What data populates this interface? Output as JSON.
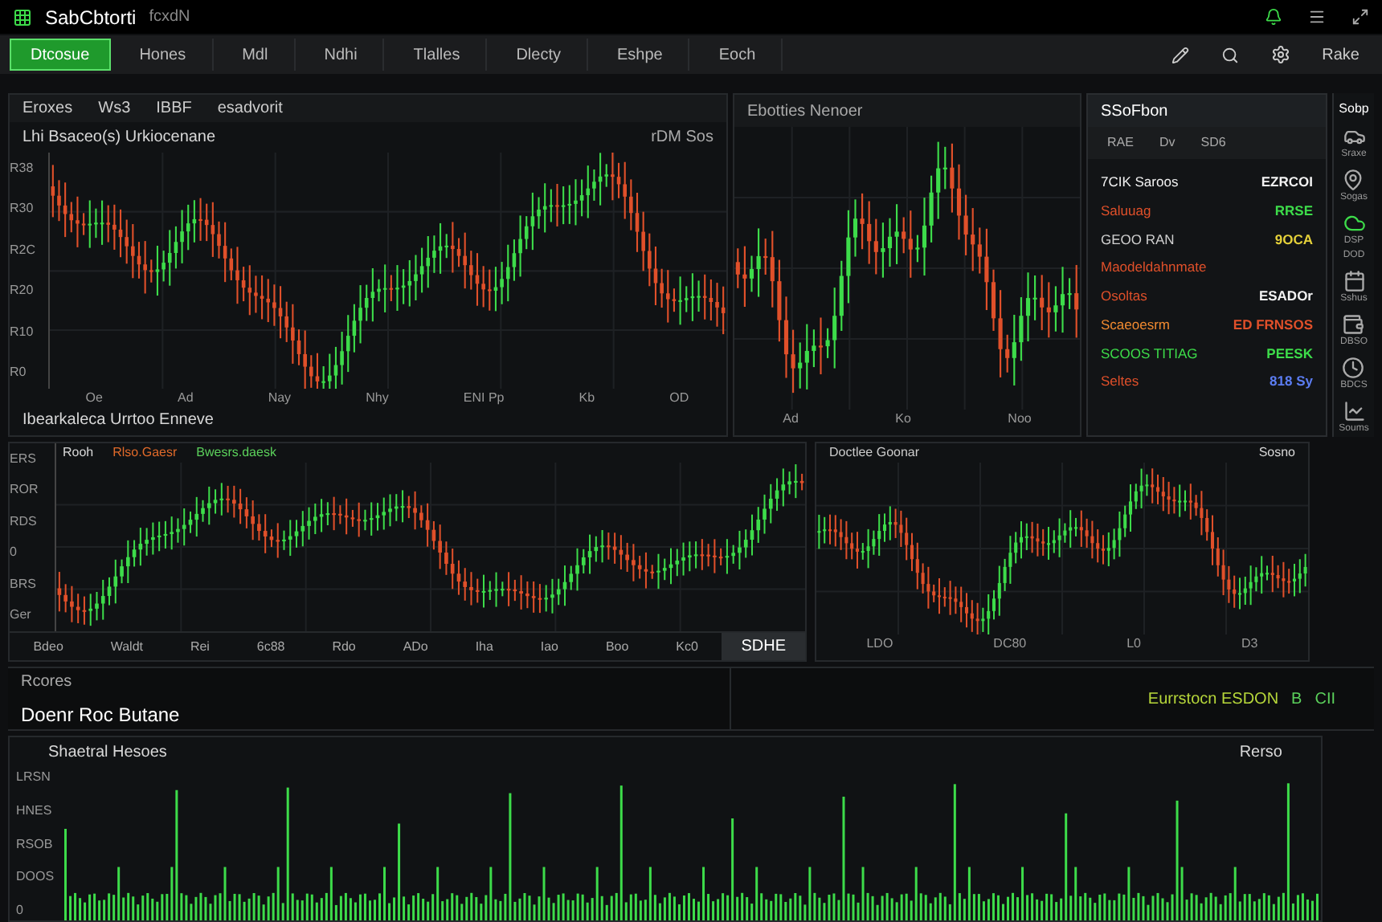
{
  "title_bar": {
    "title": "SabCbtorti",
    "subtitle": "fcxdN"
  },
  "nav": {
    "tabs": [
      {
        "label": "Dtcosue",
        "selected": true
      },
      {
        "label": "Hones",
        "selected": false
      },
      {
        "label": "Mdl",
        "selected": false
      },
      {
        "label": "Ndhi",
        "selected": false
      },
      {
        "label": "Tlalles",
        "selected": false
      },
      {
        "label": "Dlecty",
        "selected": false
      },
      {
        "label": "Eshpe",
        "selected": false
      },
      {
        "label": "Eoch",
        "selected": false
      }
    ],
    "right_label": "Rake"
  },
  "main_chart": {
    "toolbar": [
      "Eroxes",
      "Ws3",
      "IBBF",
      "esadvorit"
    ],
    "title": "Lhi Bsaceo(s) Urkiocenane",
    "corner": "rDM Sos",
    "y_labels": [
      "R38",
      "R30",
      "R2C",
      "R20",
      "R10",
      "R0"
    ],
    "x_labels": [
      "Oe",
      "Ad",
      "Nay",
      "Nhy",
      "ENI Pp",
      "Kb",
      "OD"
    ],
    "footer": "Ibearkaleca Urrtoo Enneve"
  },
  "side_chart": {
    "title": "Ebotties Nenoer",
    "x_labels": [
      "Ad",
      "Ko",
      "Noo"
    ]
  },
  "stats": {
    "title": "SSoFbon",
    "columns": [
      "RAE",
      "Dv",
      "SD6"
    ],
    "rows": [
      {
        "label": {
          "text": "7CIK Saroos",
          "color": "#f2f2f2"
        },
        "value": {
          "text": "EZRCOI",
          "color": "#f2f2f2"
        }
      },
      {
        "label": {
          "text": "Saluuag",
          "color": "#e0502a"
        },
        "value": {
          "text": "RRSE",
          "color": "#3ddc4a"
        }
      },
      {
        "label": {
          "text": "GEOO RAN",
          "color": "#cfcfcf"
        },
        "value": {
          "text": "9OCA",
          "color": "#e6d23a"
        }
      },
      {
        "label": {
          "text": "Maodeldahnmate",
          "color": "#e0502a"
        }
      },
      {
        "label": {
          "text": "Osoltas",
          "color": "#e0502a"
        },
        "value": {
          "text": "ESADOr",
          "color": "#f2f2f2"
        }
      },
      {
        "label": {
          "text": "Scaeoesrm",
          "color": "#f08a30"
        },
        "value": {
          "text": "ED FRNSOS",
          "color": "#e0502a"
        }
      },
      {
        "label": {
          "text": "SCOOS TITIAG",
          "color": "#3ddc4a"
        },
        "value": {
          "text": "PEESK",
          "color": "#3ddc4a"
        }
      },
      {
        "label": {
          "text": "Seltes",
          "color": "#e0502a"
        },
        "value": {
          "text": "818 Sy",
          "color": "#5b7cf0"
        }
      }
    ]
  },
  "sidebar": {
    "title": "Sobp",
    "items": [
      {
        "label": "Sraxe"
      },
      {
        "label": "Sogas"
      },
      {
        "label": "DSP DOD"
      },
      {
        "label": "Sshus"
      },
      {
        "label": "DBSO"
      },
      {
        "label": "BDCS"
      },
      {
        "label": "Soums"
      }
    ]
  },
  "lower_chart": {
    "label": "Rooh",
    "legend": [
      "Rlso.Gaesr",
      "Bwesrs.daesk"
    ],
    "y_labels": [
      "ERS",
      "ROR",
      "RDS",
      "0",
      "BRS",
      "Ger"
    ],
    "x_labels": [
      "Bdeo",
      "Waldt",
      "Rei",
      "6c88",
      "Rdo",
      "ADo",
      "Iha",
      "Iao",
      "Boo",
      "Kc0"
    ],
    "button": "SDHE"
  },
  "right_chart": {
    "legend": "Doctlee Goonar",
    "corner": "Sosno",
    "x_labels": [
      "LDO",
      "DC80",
      "L0",
      "D3"
    ]
  },
  "strip": {
    "title": "Rcores",
    "label": "Doenr Roc Butane",
    "status": "Eurrstocn ESDON",
    "status_codes": [
      "B",
      "CII"
    ]
  },
  "volume": {
    "title": "Shaetral Hesoes",
    "corner": "Rerso",
    "y_labels": [
      "LRSN",
      "HNES",
      "RSOB",
      "DOOS",
      "0"
    ]
  }
}
